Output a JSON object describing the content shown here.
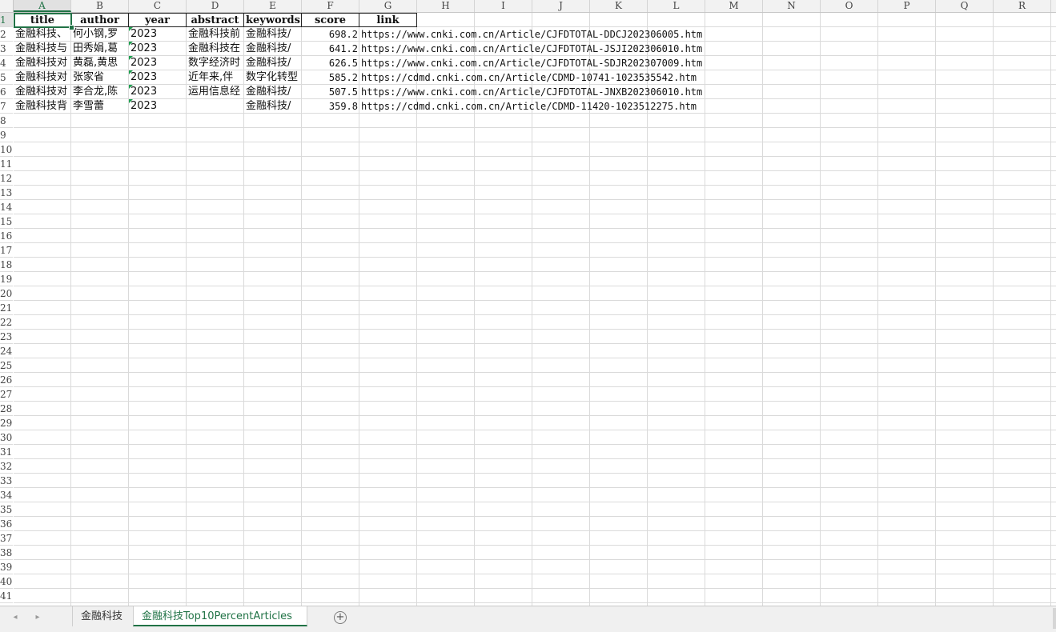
{
  "columns": [
    "A",
    "B",
    "C",
    "D",
    "E",
    "F",
    "G",
    "H",
    "I",
    "J",
    "K",
    "L",
    "M",
    "N",
    "O",
    "P",
    "Q",
    "R"
  ],
  "active_column": "A",
  "rows": [
    "1",
    "2",
    "3",
    "4",
    "5",
    "6",
    "7",
    "8",
    "9",
    "10",
    "11",
    "12",
    "13",
    "14",
    "15",
    "16",
    "17",
    "18",
    "19",
    "20",
    "21",
    "22",
    "23",
    "24",
    "25",
    "26",
    "27",
    "28",
    "29",
    "30",
    "31",
    "32",
    "33",
    "34",
    "35",
    "36",
    "37",
    "38",
    "39",
    "40",
    "41"
  ],
  "active_row": "1",
  "header_row": [
    "title",
    "author",
    "year",
    "abstract",
    "keywords",
    "score",
    "link"
  ],
  "data_rows": [
    {
      "title": "金融科技、",
      "author": "何小钢,罗",
      "year": "2023",
      "abstract": "金融科技前",
      "keywords": "金融科技/",
      "score": "698.2",
      "link": "https://www.cnki.com.cn/Article/CJFDTOTAL-DDCJ202306005.htm"
    },
    {
      "title": "金融科技与",
      "author": "田秀娟,葛",
      "year": "2023",
      "abstract": "金融科技在",
      "keywords": "金融科技/",
      "score": "641.2",
      "link": "https://www.cnki.com.cn/Article/CJFDTOTAL-JSJI202306010.htm"
    },
    {
      "title": "金融科技对",
      "author": "黄磊,黄思",
      "year": "2023",
      "abstract": "数字经济时",
      "keywords": "金融科技/",
      "score": "626.5",
      "link": "https://www.cnki.com.cn/Article/CJFDTOTAL-SDJR202307009.htm"
    },
    {
      "title": "金融科技对",
      "author": "张家省",
      "year": "2023",
      "abstract": "近年来,伴",
      "keywords": "数字化转型",
      "score": "585.2",
      "link": "https://cdmd.cnki.com.cn/Article/CDMD-10741-1023535542.htm"
    },
    {
      "title": "金融科技对",
      "author": "李合龙,陈",
      "year": "2023",
      "abstract": "运用信息经",
      "keywords": "金融科技/",
      "score": "507.5",
      "link": "https://www.cnki.com.cn/Article/CJFDTOTAL-JNXB202306010.htm"
    },
    {
      "title": "金融科技背",
      "author": "李雪蕾",
      "year": "2023",
      "abstract": "",
      "keywords": "金融科技/",
      "score": "359.8",
      "link": "https://cdmd.cnki.com.cn/Article/CDMD-11420-1023512275.htm"
    }
  ],
  "sheet_tabs": [
    {
      "label": "金融科技",
      "active": false
    },
    {
      "label": "金融科技Top10PercentArticles",
      "active": true
    }
  ],
  "nav": {
    "prev_icon": "◂",
    "next_icon": "▸",
    "add_icon": "+"
  },
  "colors": {
    "accent": "#217346",
    "number_marker": "#1e9f4f"
  }
}
